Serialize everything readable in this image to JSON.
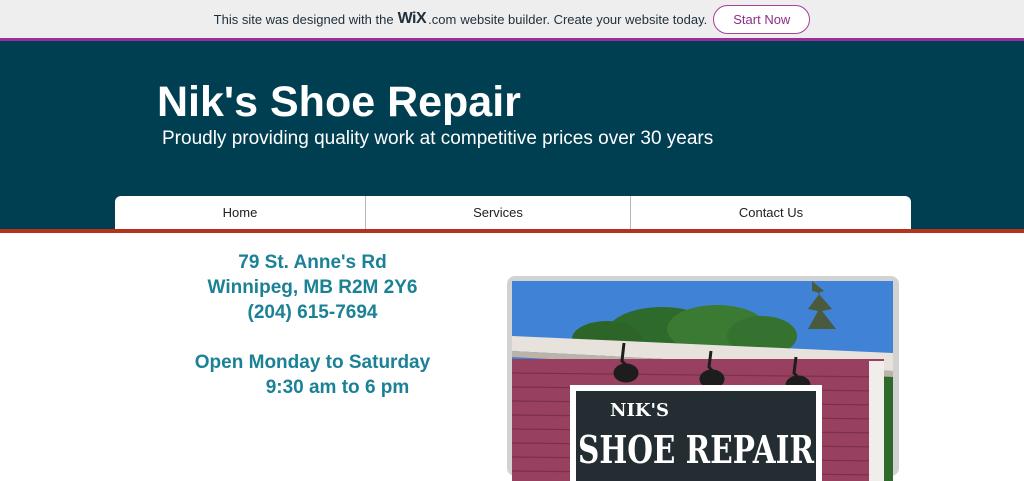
{
  "wix_banner": {
    "text_before": "This site was designed with the",
    "logo_text": "WiX",
    "dotcom": ".com",
    "text_after": "website builder. Create your website today.",
    "button_label": "Start Now"
  },
  "header": {
    "title": "Nik's Shoe Repair",
    "tagline": "Proudly providing quality work at competitive prices over 30 years"
  },
  "nav": {
    "items": [
      {
        "label": "Home"
      },
      {
        "label": "Services"
      },
      {
        "label": "Contact Us"
      }
    ]
  },
  "contact": {
    "address_line1": "79 St. Anne's Rd",
    "address_line2": "Winnipeg, MB R2M 2Y6",
    "phone": "(204) 615-7694",
    "hours_title": "Open Monday to Saturday",
    "hours_time": "9:30 am to 6 pm"
  },
  "photo": {
    "sign_small": "NIK'S",
    "sign_large": "SHOE REPAIR"
  },
  "colors": {
    "header_bg": "#003f51",
    "accent_purple": "#9b2f9a",
    "accent_red": "#b3331d",
    "info_text": "#1b8196"
  }
}
